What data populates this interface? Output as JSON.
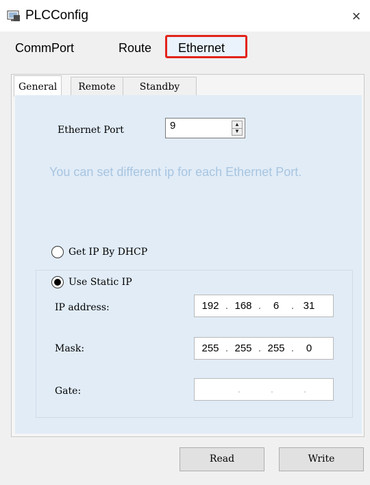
{
  "window": {
    "title": "PLCConfig",
    "close_label": "×"
  },
  "top_tabs": [
    {
      "label": "CommPort"
    },
    {
      "label": "Route"
    },
    {
      "label": "Ethernet",
      "selected": true
    }
  ],
  "sub_tabs": [
    {
      "label": "General",
      "selected": true
    },
    {
      "label": "Remote"
    },
    {
      "label": "Standby"
    }
  ],
  "ethernet_port": {
    "label": "Ethernet Port",
    "value": "9"
  },
  "hint_text": "You can set different ip for each Ethernet Port.",
  "ip_mode": {
    "dhcp_label": "Get IP By DHCP",
    "static_label": "Use Static IP",
    "selected": "static"
  },
  "fields": {
    "ip": {
      "label": "IP address:",
      "octets": [
        "192",
        "168",
        "6",
        "31"
      ]
    },
    "mask": {
      "label": "Mask:",
      "octets": [
        "255",
        "255",
        "255",
        "0"
      ]
    },
    "gate": {
      "label": "Gate:",
      "octets": [
        "",
        "",
        "",
        ""
      ]
    }
  },
  "buttons": {
    "read": "Read",
    "write": "Write"
  },
  "colors": {
    "highlight_border": "#e2231a",
    "tab_page_bg": "#e1ecf7",
    "hint_text": "#a8c5e0"
  },
  "icons": {
    "app": "plc-app-icon",
    "close": "close-icon",
    "spin_up": "up-arrow-icon",
    "spin_down": "down-arrow-icon"
  }
}
